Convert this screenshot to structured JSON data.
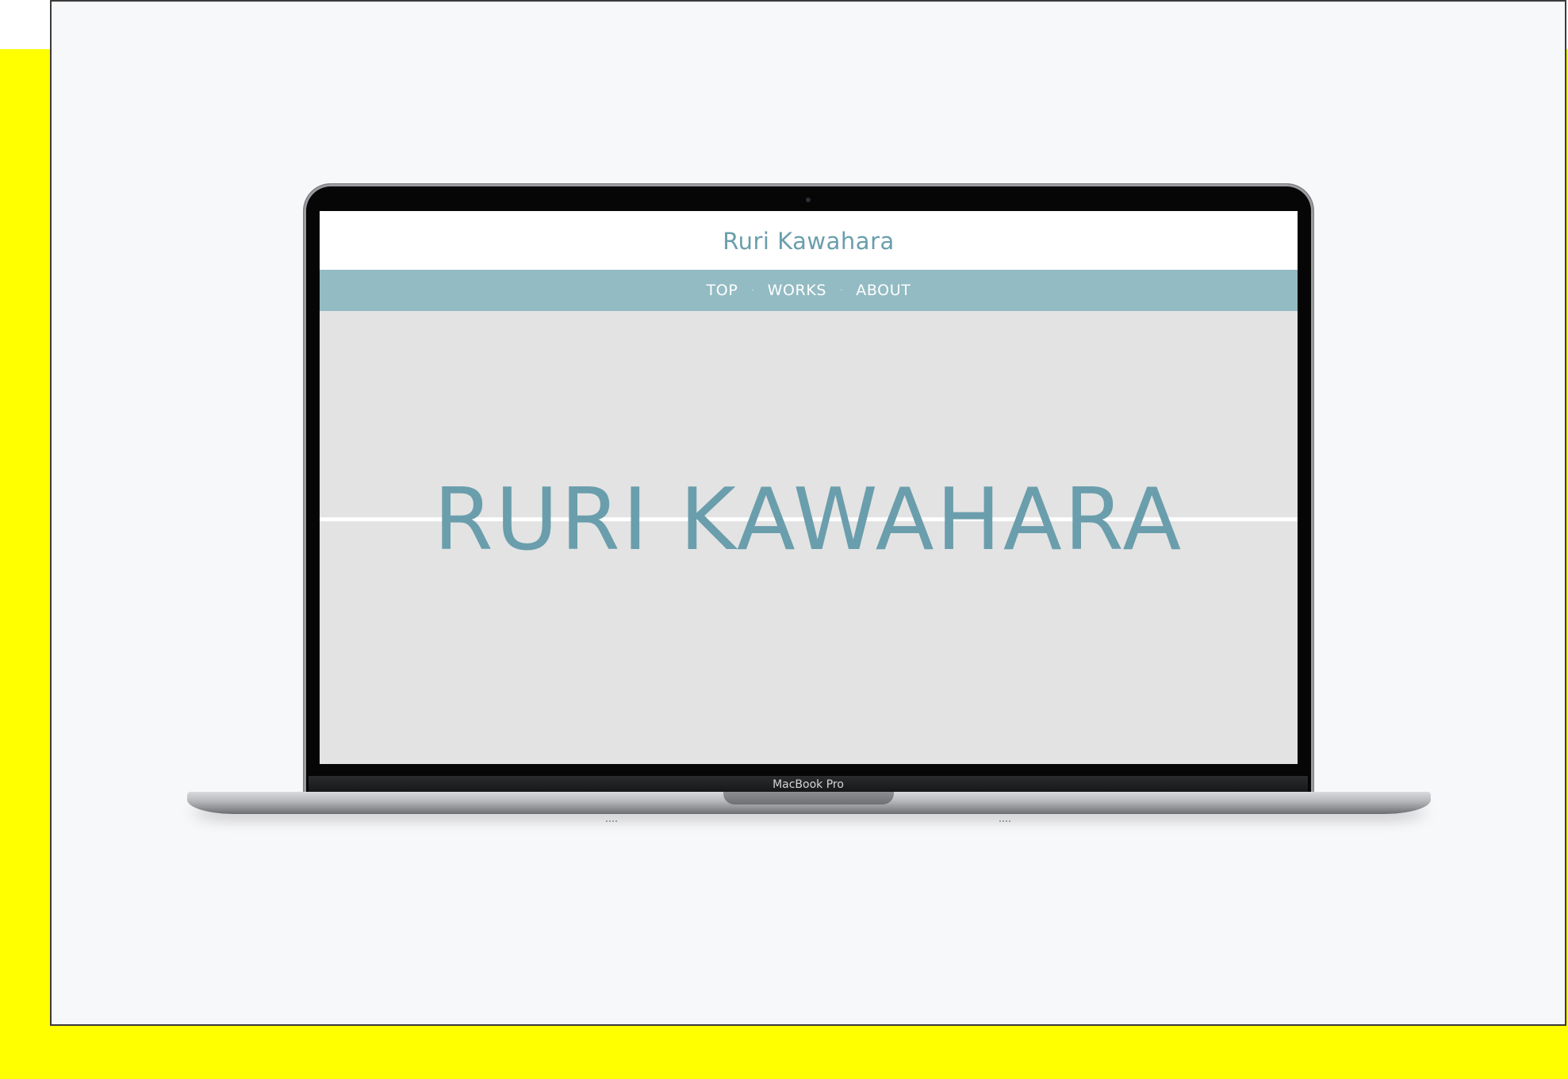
{
  "device": {
    "bezel_label": "MacBook Pro"
  },
  "website": {
    "header_title": "Ruri Kawahara",
    "nav": {
      "items": [
        {
          "label": "TOP"
        },
        {
          "label": "WORKS"
        },
        {
          "label": "ABOUT"
        }
      ],
      "separator": "·"
    },
    "hero_title": "RURI KAWAHARA"
  },
  "colors": {
    "background_accent": "#ffff00",
    "frame_background": "#f7f8fa",
    "site_accent": "#6a9eac",
    "nav_bar": "#93bbc3",
    "hero_background": "#e3e3e3"
  }
}
